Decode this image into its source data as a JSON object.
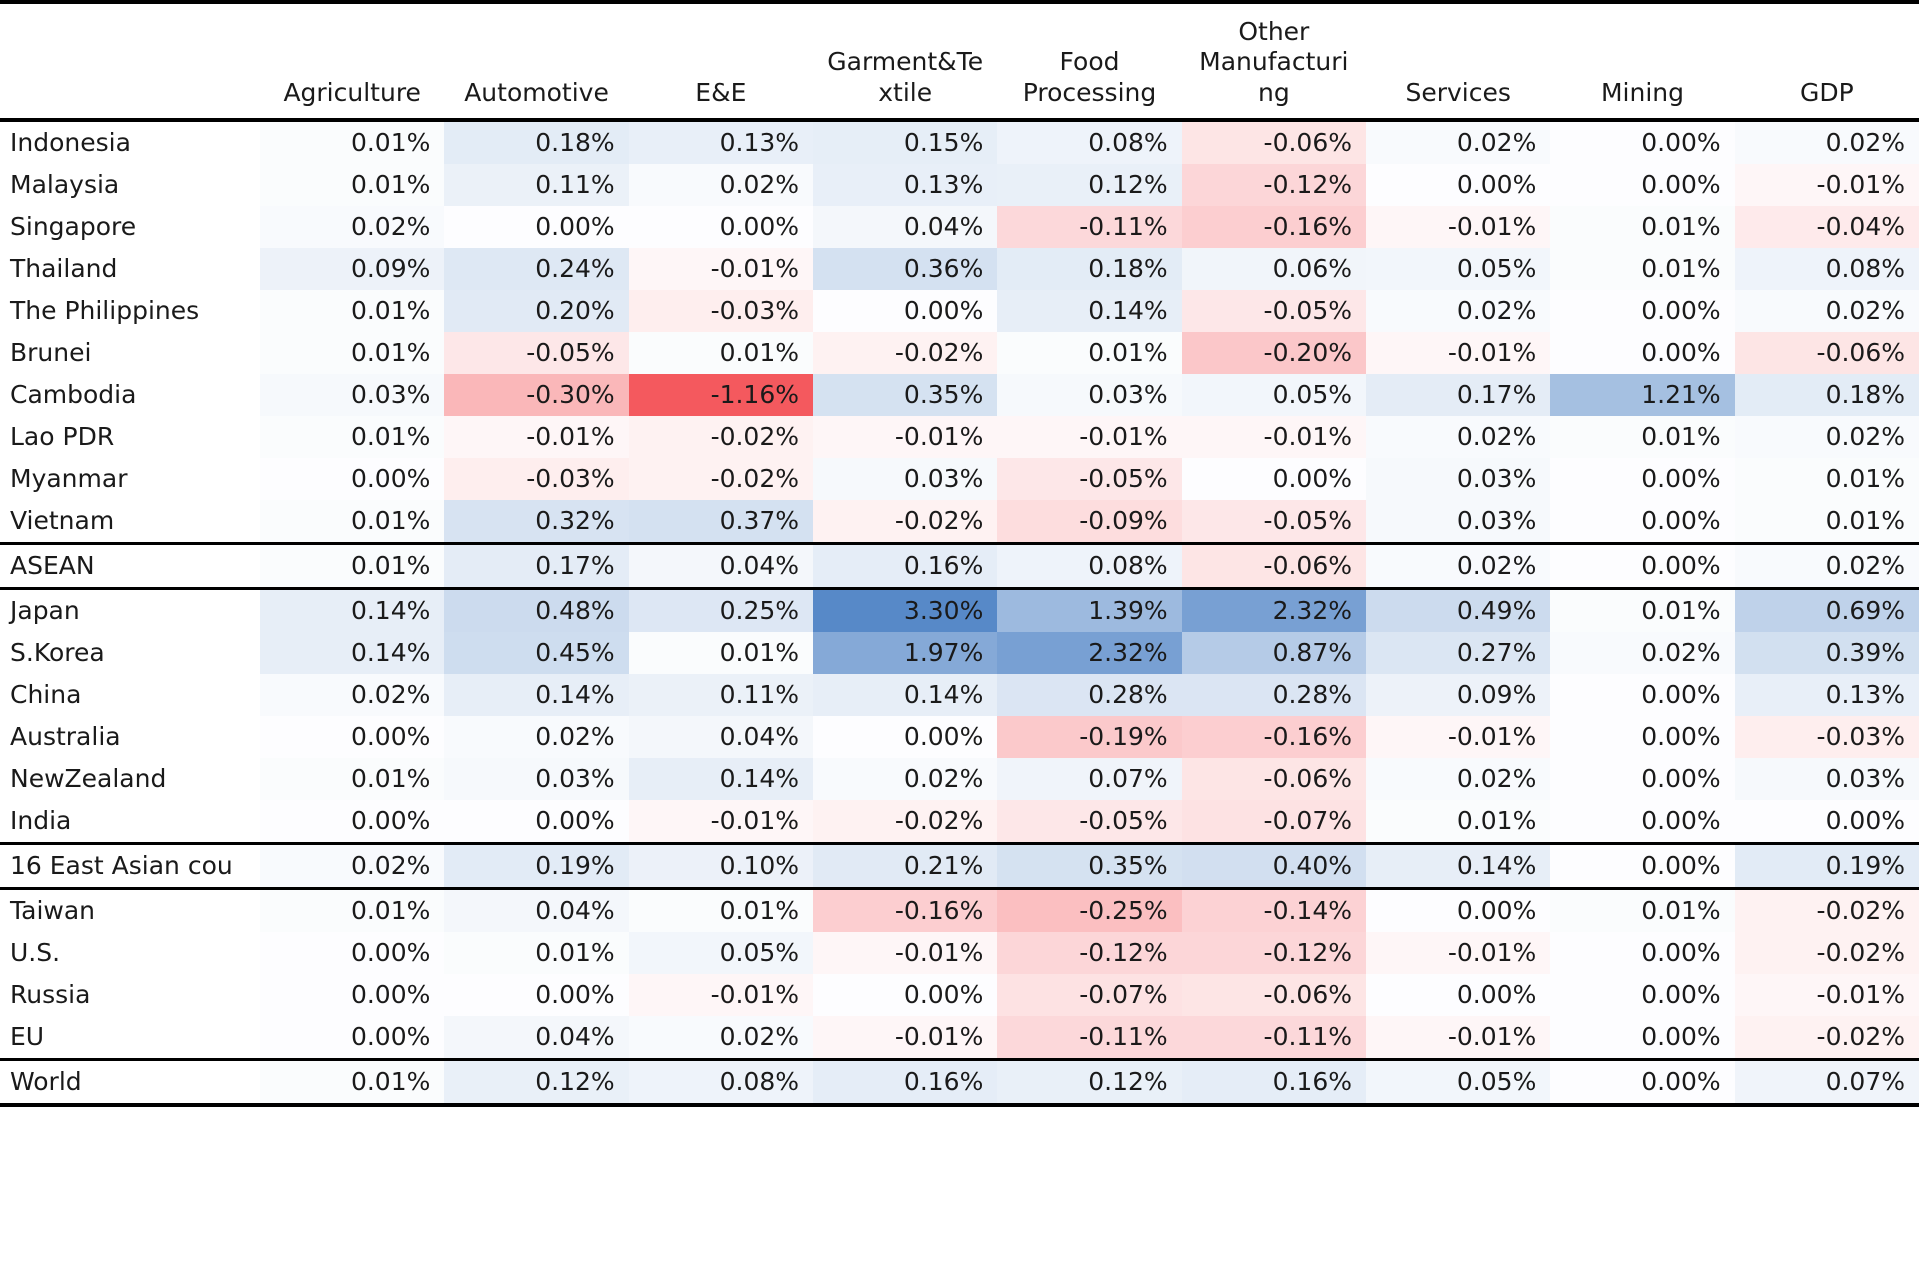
{
  "table": {
    "row_label_header": "",
    "columns": [
      "Agriculture",
      "Automotive",
      "E&E",
      "Garment&Textile",
      "Food Processing",
      "Other Manufacturing",
      "Services",
      "Mining",
      "GDP"
    ],
    "column_wraps": [
      "Agriculture",
      "Automotive",
      "E&E",
      "Garment&Te\nxtile",
      "Food\nProcessing",
      "Other\nManufacturi\nng",
      "Services",
      "Mining",
      "GDP"
    ],
    "rows": [
      {
        "label": "Indonesia",
        "values": [
          "0.01%",
          "0.18%",
          "0.13%",
          "0.15%",
          "0.08%",
          "-0.06%",
          "0.02%",
          "0.00%",
          "0.02%"
        ],
        "nums": [
          0.01,
          0.18,
          0.13,
          0.15,
          0.08,
          -0.06,
          0.02,
          0.0,
          0.02
        ],
        "sep_above": false,
        "sep_below": false
      },
      {
        "label": "Malaysia",
        "values": [
          "0.01%",
          "0.11%",
          "0.02%",
          "0.13%",
          "0.12%",
          "-0.12%",
          "0.00%",
          "0.00%",
          "-0.01%"
        ],
        "nums": [
          0.01,
          0.11,
          0.02,
          0.13,
          0.12,
          -0.12,
          0.0,
          0.0,
          -0.01
        ],
        "sep_above": false,
        "sep_below": false
      },
      {
        "label": "Singapore",
        "values": [
          "0.02%",
          "0.00%",
          "0.00%",
          "0.04%",
          "-0.11%",
          "-0.16%",
          "-0.01%",
          "0.01%",
          "-0.04%"
        ],
        "nums": [
          0.02,
          0.0,
          0.0,
          0.04,
          -0.11,
          -0.16,
          -0.01,
          0.01,
          -0.04
        ],
        "sep_above": false,
        "sep_below": false
      },
      {
        "label": "Thailand",
        "values": [
          "0.09%",
          "0.24%",
          "-0.01%",
          "0.36%",
          "0.18%",
          "0.06%",
          "0.05%",
          "0.01%",
          "0.08%"
        ],
        "nums": [
          0.09,
          0.24,
          -0.01,
          0.36,
          0.18,
          0.06,
          0.05,
          0.01,
          0.08
        ],
        "sep_above": false,
        "sep_below": false
      },
      {
        "label": "The Philippines",
        "values": [
          "0.01%",
          "0.20%",
          "-0.03%",
          "0.00%",
          "0.14%",
          "-0.05%",
          "0.02%",
          "0.00%",
          "0.02%"
        ],
        "nums": [
          0.01,
          0.2,
          -0.03,
          0.0,
          0.14,
          -0.05,
          0.02,
          0.0,
          0.02
        ],
        "sep_above": false,
        "sep_below": false
      },
      {
        "label": "Brunei",
        "values": [
          "0.01%",
          "-0.05%",
          "0.01%",
          "-0.02%",
          "0.01%",
          "-0.20%",
          "-0.01%",
          "0.00%",
          "-0.06%"
        ],
        "nums": [
          0.01,
          -0.05,
          0.01,
          -0.02,
          0.01,
          -0.2,
          -0.01,
          0.0,
          -0.06
        ],
        "sep_above": false,
        "sep_below": false
      },
      {
        "label": "Cambodia",
        "values": [
          "0.03%",
          "-0.30%",
          "-1.16%",
          "0.35%",
          "0.03%",
          "0.05%",
          "0.17%",
          "1.21%",
          "0.18%"
        ],
        "nums": [
          0.03,
          -0.3,
          -1.16,
          0.35,
          0.03,
          0.05,
          0.17,
          1.21,
          0.18
        ],
        "sep_above": false,
        "sep_below": false
      },
      {
        "label": "Lao PDR",
        "values": [
          "0.01%",
          "-0.01%",
          "-0.02%",
          "-0.01%",
          "-0.01%",
          "-0.01%",
          "0.02%",
          "0.01%",
          "0.02%"
        ],
        "nums": [
          0.01,
          -0.01,
          -0.02,
          -0.01,
          -0.01,
          -0.01,
          0.02,
          0.01,
          0.02
        ],
        "sep_above": false,
        "sep_below": false
      },
      {
        "label": "Myanmar",
        "values": [
          "0.00%",
          "-0.03%",
          "-0.02%",
          "0.03%",
          "-0.05%",
          "0.00%",
          "0.03%",
          "0.00%",
          "0.01%"
        ],
        "nums": [
          0.0,
          -0.03,
          -0.02,
          0.03,
          -0.05,
          0.0,
          0.03,
          0.0,
          0.01
        ],
        "sep_above": false,
        "sep_below": false
      },
      {
        "label": "Vietnam",
        "values": [
          "0.01%",
          "0.32%",
          "0.37%",
          "-0.02%",
          "-0.09%",
          "-0.05%",
          "0.03%",
          "0.00%",
          "0.01%"
        ],
        "nums": [
          0.01,
          0.32,
          0.37,
          -0.02,
          -0.09,
          -0.05,
          0.03,
          0.0,
          0.01
        ],
        "sep_above": false,
        "sep_below": false
      },
      {
        "label": "ASEAN",
        "values": [
          "0.01%",
          "0.17%",
          "0.04%",
          "0.16%",
          "0.08%",
          "-0.06%",
          "0.02%",
          "0.00%",
          "0.02%"
        ],
        "nums": [
          0.01,
          0.17,
          0.04,
          0.16,
          0.08,
          -0.06,
          0.02,
          0.0,
          0.02
        ],
        "sep_above": true,
        "sep_below": true
      },
      {
        "label": "Japan",
        "values": [
          "0.14%",
          "0.48%",
          "0.25%",
          "3.30%",
          "1.39%",
          "2.32%",
          "0.49%",
          "0.01%",
          "0.69%"
        ],
        "nums": [
          0.14,
          0.48,
          0.25,
          3.3,
          1.39,
          2.32,
          0.49,
          0.01,
          0.69
        ],
        "sep_above": false,
        "sep_below": false
      },
      {
        "label": "S.Korea",
        "values": [
          "0.14%",
          "0.45%",
          "0.01%",
          "1.97%",
          "2.32%",
          "0.87%",
          "0.27%",
          "0.02%",
          "0.39%"
        ],
        "nums": [
          0.14,
          0.45,
          0.01,
          1.97,
          2.32,
          0.87,
          0.27,
          0.02,
          0.39
        ],
        "sep_above": false,
        "sep_below": false
      },
      {
        "label": "China",
        "values": [
          "0.02%",
          "0.14%",
          "0.11%",
          "0.14%",
          "0.28%",
          "0.28%",
          "0.09%",
          "0.00%",
          "0.13%"
        ],
        "nums": [
          0.02,
          0.14,
          0.11,
          0.14,
          0.28,
          0.28,
          0.09,
          0.0,
          0.13
        ],
        "sep_above": false,
        "sep_below": false
      },
      {
        "label": "Australia",
        "values": [
          "0.00%",
          "0.02%",
          "0.04%",
          "0.00%",
          "-0.19%",
          "-0.16%",
          "-0.01%",
          "0.00%",
          "-0.03%"
        ],
        "nums": [
          0.0,
          0.02,
          0.04,
          0.0,
          -0.19,
          -0.16,
          -0.01,
          0.0,
          -0.03
        ],
        "sep_above": false,
        "sep_below": false
      },
      {
        "label": "NewZealand",
        "values": [
          "0.01%",
          "0.03%",
          "0.14%",
          "0.02%",
          "0.07%",
          "-0.06%",
          "0.02%",
          "0.00%",
          "0.03%"
        ],
        "nums": [
          0.01,
          0.03,
          0.14,
          0.02,
          0.07,
          -0.06,
          0.02,
          0.0,
          0.03
        ],
        "sep_above": false,
        "sep_below": false
      },
      {
        "label": "India",
        "values": [
          "0.00%",
          "0.00%",
          "-0.01%",
          "-0.02%",
          "-0.05%",
          "-0.07%",
          "0.01%",
          "0.00%",
          "0.00%"
        ],
        "nums": [
          0.0,
          0.0,
          -0.01,
          -0.02,
          -0.05,
          -0.07,
          0.01,
          0.0,
          0.0
        ],
        "sep_above": false,
        "sep_below": false
      },
      {
        "label": "16 East Asian cou",
        "values": [
          "0.02%",
          "0.19%",
          "0.10%",
          "0.21%",
          "0.35%",
          "0.40%",
          "0.14%",
          "0.00%",
          "0.19%"
        ],
        "nums": [
          0.02,
          0.19,
          0.1,
          0.21,
          0.35,
          0.4,
          0.14,
          0.0,
          0.19
        ],
        "sep_above": true,
        "sep_below": true
      },
      {
        "label": "Taiwan",
        "values": [
          "0.01%",
          "0.04%",
          "0.01%",
          "-0.16%",
          "-0.25%",
          "-0.14%",
          "0.00%",
          "0.01%",
          "-0.02%"
        ],
        "nums": [
          0.01,
          0.04,
          0.01,
          -0.16,
          -0.25,
          -0.14,
          0.0,
          0.01,
          -0.02
        ],
        "sep_above": false,
        "sep_below": false
      },
      {
        "label": "U.S.",
        "values": [
          "0.00%",
          "0.01%",
          "0.05%",
          "-0.01%",
          "-0.12%",
          "-0.12%",
          "-0.01%",
          "0.00%",
          "-0.02%"
        ],
        "nums": [
          0.0,
          0.01,
          0.05,
          -0.01,
          -0.12,
          -0.12,
          -0.01,
          0.0,
          -0.02
        ],
        "sep_above": false,
        "sep_below": false
      },
      {
        "label": "Russia",
        "values": [
          "0.00%",
          "0.00%",
          "-0.01%",
          "0.00%",
          "-0.07%",
          "-0.06%",
          "0.00%",
          "0.00%",
          "-0.01%"
        ],
        "nums": [
          0.0,
          0.0,
          -0.01,
          0.0,
          -0.07,
          -0.06,
          0.0,
          0.0,
          -0.01
        ],
        "sep_above": false,
        "sep_below": false
      },
      {
        "label": "EU",
        "values": [
          "0.00%",
          "0.04%",
          "0.02%",
          "-0.01%",
          "-0.11%",
          "-0.11%",
          "-0.01%",
          "0.00%",
          "-0.02%"
        ],
        "nums": [
          0.0,
          0.04,
          0.02,
          -0.01,
          -0.11,
          -0.11,
          -0.01,
          0.0,
          -0.02
        ],
        "sep_above": false,
        "sep_below": false
      },
      {
        "label": "World",
        "values": [
          "0.01%",
          "0.12%",
          "0.08%",
          "0.16%",
          "0.12%",
          "0.16%",
          "0.05%",
          "0.00%",
          "0.07%"
        ],
        "nums": [
          0.01,
          0.12,
          0.08,
          0.16,
          0.12,
          0.16,
          0.05,
          0.0,
          0.07
        ],
        "sep_above": true,
        "sep_below": false
      }
    ]
  },
  "heatmap": {
    "positive_color": "#5789c8",
    "negative_color": "#f4595e",
    "neutral_color": "#ffffff",
    "max_positive": 3.3,
    "max_negative": -1.16,
    "scale_exponent": 0.62
  },
  "chart_data": {
    "type": "heatmap",
    "title": "",
    "xlabel": "",
    "ylabel": "",
    "categories": [
      "Agriculture",
      "Automotive",
      "E&E",
      "Garment&Textile",
      "Food Processing",
      "Other Manufacturing",
      "Services",
      "Mining",
      "GDP"
    ],
    "rows": [
      "Indonesia",
      "Malaysia",
      "Singapore",
      "Thailand",
      "The Philippines",
      "Brunei",
      "Cambodia",
      "Lao PDR",
      "Myanmar",
      "Vietnam",
      "ASEAN",
      "Japan",
      "S.Korea",
      "China",
      "Australia",
      "NewZealand",
      "India",
      "16 East Asian cou",
      "Taiwan",
      "U.S.",
      "Russia",
      "EU",
      "World"
    ],
    "units": "percent",
    "values": [
      [
        0.01,
        0.18,
        0.13,
        0.15,
        0.08,
        -0.06,
        0.02,
        0.0,
        0.02
      ],
      [
        0.01,
        0.11,
        0.02,
        0.13,
        0.12,
        -0.12,
        0.0,
        0.0,
        -0.01
      ],
      [
        0.02,
        0.0,
        0.0,
        0.04,
        -0.11,
        -0.16,
        -0.01,
        0.01,
        -0.04
      ],
      [
        0.09,
        0.24,
        -0.01,
        0.36,
        0.18,
        0.06,
        0.05,
        0.01,
        0.08
      ],
      [
        0.01,
        0.2,
        -0.03,
        0.0,
        0.14,
        -0.05,
        0.02,
        0.0,
        0.02
      ],
      [
        0.01,
        -0.05,
        0.01,
        -0.02,
        0.01,
        -0.2,
        -0.01,
        0.0,
        -0.06
      ],
      [
        0.03,
        -0.3,
        -1.16,
        0.35,
        0.03,
        0.05,
        0.17,
        1.21,
        0.18
      ],
      [
        0.01,
        -0.01,
        -0.02,
        -0.01,
        -0.01,
        -0.01,
        0.02,
        0.01,
        0.02
      ],
      [
        0.0,
        -0.03,
        -0.02,
        0.03,
        -0.05,
        0.0,
        0.03,
        0.0,
        0.01
      ],
      [
        0.01,
        0.32,
        0.37,
        -0.02,
        -0.09,
        -0.05,
        0.03,
        0.0,
        0.01
      ],
      [
        0.01,
        0.17,
        0.04,
        0.16,
        0.08,
        -0.06,
        0.02,
        0.0,
        0.02
      ],
      [
        0.14,
        0.48,
        0.25,
        3.3,
        1.39,
        2.32,
        0.49,
        0.01,
        0.69
      ],
      [
        0.14,
        0.45,
        0.01,
        1.97,
        2.32,
        0.87,
        0.27,
        0.02,
        0.39
      ],
      [
        0.02,
        0.14,
        0.11,
        0.14,
        0.28,
        0.28,
        0.09,
        0.0,
        0.13
      ],
      [
        0.0,
        0.02,
        0.04,
        0.0,
        -0.19,
        -0.16,
        -0.01,
        0.0,
        -0.03
      ],
      [
        0.01,
        0.03,
        0.14,
        0.02,
        0.07,
        -0.06,
        0.02,
        0.0,
        0.03
      ],
      [
        0.0,
        0.0,
        -0.01,
        -0.02,
        -0.05,
        -0.07,
        0.01,
        0.0,
        0.0
      ],
      [
        0.02,
        0.19,
        0.1,
        0.21,
        0.35,
        0.4,
        0.14,
        0.0,
        0.19
      ],
      [
        0.01,
        0.04,
        0.01,
        -0.16,
        -0.25,
        -0.14,
        0.0,
        0.01,
        -0.02
      ],
      [
        0.0,
        0.01,
        0.05,
        -0.01,
        -0.12,
        -0.12,
        -0.01,
        0.0,
        -0.02
      ],
      [
        0.0,
        0.0,
        -0.01,
        0.0,
        -0.07,
        -0.06,
        0.0,
        0.0,
        -0.01
      ],
      [
        0.0,
        0.04,
        0.02,
        -0.01,
        -0.11,
        -0.11,
        -0.01,
        0.0,
        -0.02
      ],
      [
        0.01,
        0.12,
        0.08,
        0.16,
        0.12,
        0.16,
        0.05,
        0.0,
        0.07
      ]
    ],
    "colormap": "diverging red-white-blue (negative=red, positive=blue)",
    "vmin": -1.16,
    "vmax": 3.3,
    "grid": false,
    "legend": "none"
  }
}
